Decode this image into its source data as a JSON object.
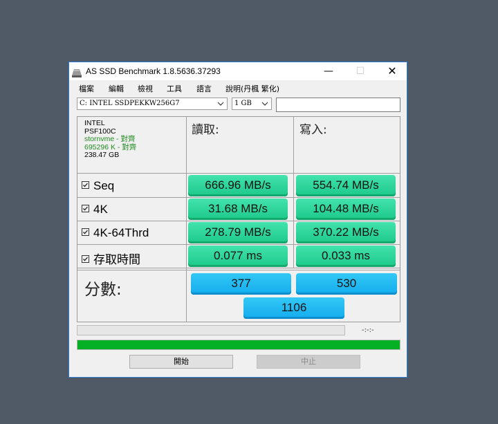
{
  "window": {
    "title": "AS SSD Benchmark 1.8.5636.37293",
    "minimize_glyph": "—",
    "maximize_glyph": "☐",
    "close_glyph": "✕"
  },
  "menu": [
    "檔案",
    "編輯",
    "檢視",
    "工具",
    "語言",
    "說明(丹楓 繁化)"
  ],
  "drive": {
    "selected": "C: INTEL SSDPEKKW256G7"
  },
  "size": {
    "selected": "1 GB"
  },
  "info": {
    "vendor": "INTEL",
    "firmware": "PSF100C",
    "driver": "stornvme - 對齊",
    "alignment": "695296 K - 對齊",
    "capacity": "238.47 GB"
  },
  "headers": {
    "read": "讀取:",
    "write": "寫入:"
  },
  "tests": [
    {
      "label": "Seq",
      "checked": true,
      "read": "666.96 MB/s",
      "write": "554.74 MB/s"
    },
    {
      "label": "4K",
      "checked": true,
      "read": "31.68 MB/s",
      "write": "104.48 MB/s"
    },
    {
      "label": "4K-64Thrd",
      "checked": true,
      "read": "278.79 MB/s",
      "write": "370.22 MB/s"
    },
    {
      "label": "存取時間",
      "checked": true,
      "read": "0.077 ms",
      "write": "0.033 ms"
    }
  ],
  "score": {
    "label": "分數:",
    "read": "377",
    "write": "530",
    "total": "1106"
  },
  "status": {
    "time": "-:-:-",
    "progress_fraction": 1.0
  },
  "buttons": {
    "start": "開始",
    "stop": "中止"
  },
  "colors": {
    "result_green": "#2ad69a",
    "score_blue": "#1fb8f0",
    "progress_green": "#06b025"
  }
}
